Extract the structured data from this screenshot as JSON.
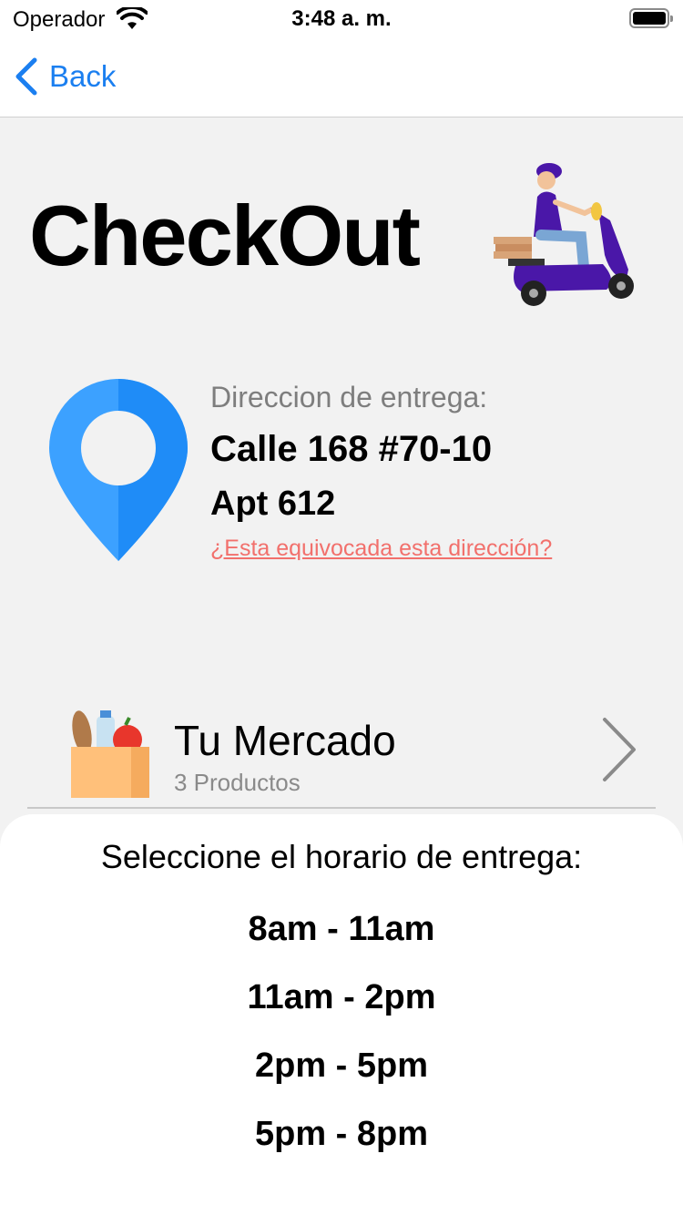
{
  "status_bar": {
    "carrier": "Operador",
    "time": "3:48 a. m."
  },
  "nav": {
    "back_label": "Back"
  },
  "title": "CheckOut",
  "address": {
    "label": "Direccion de entrega:",
    "line1": "Calle 168 #70-10",
    "line2": "Apt 612",
    "wrong_link": "¿Esta equivocada esta dirección?"
  },
  "market": {
    "title": "Tu Mercado",
    "subtitle": "3 Productos"
  },
  "delivery": {
    "prompt": "Seleccione el horario de entrega:",
    "slots": [
      "8am - 11am",
      "11am - 2pm",
      "2pm - 5pm",
      "5pm - 8pm"
    ]
  },
  "colors": {
    "accent": "#1b7ff0",
    "link": "#f2706c",
    "pin": "#2190ff",
    "scooter": "#4a17a8"
  }
}
